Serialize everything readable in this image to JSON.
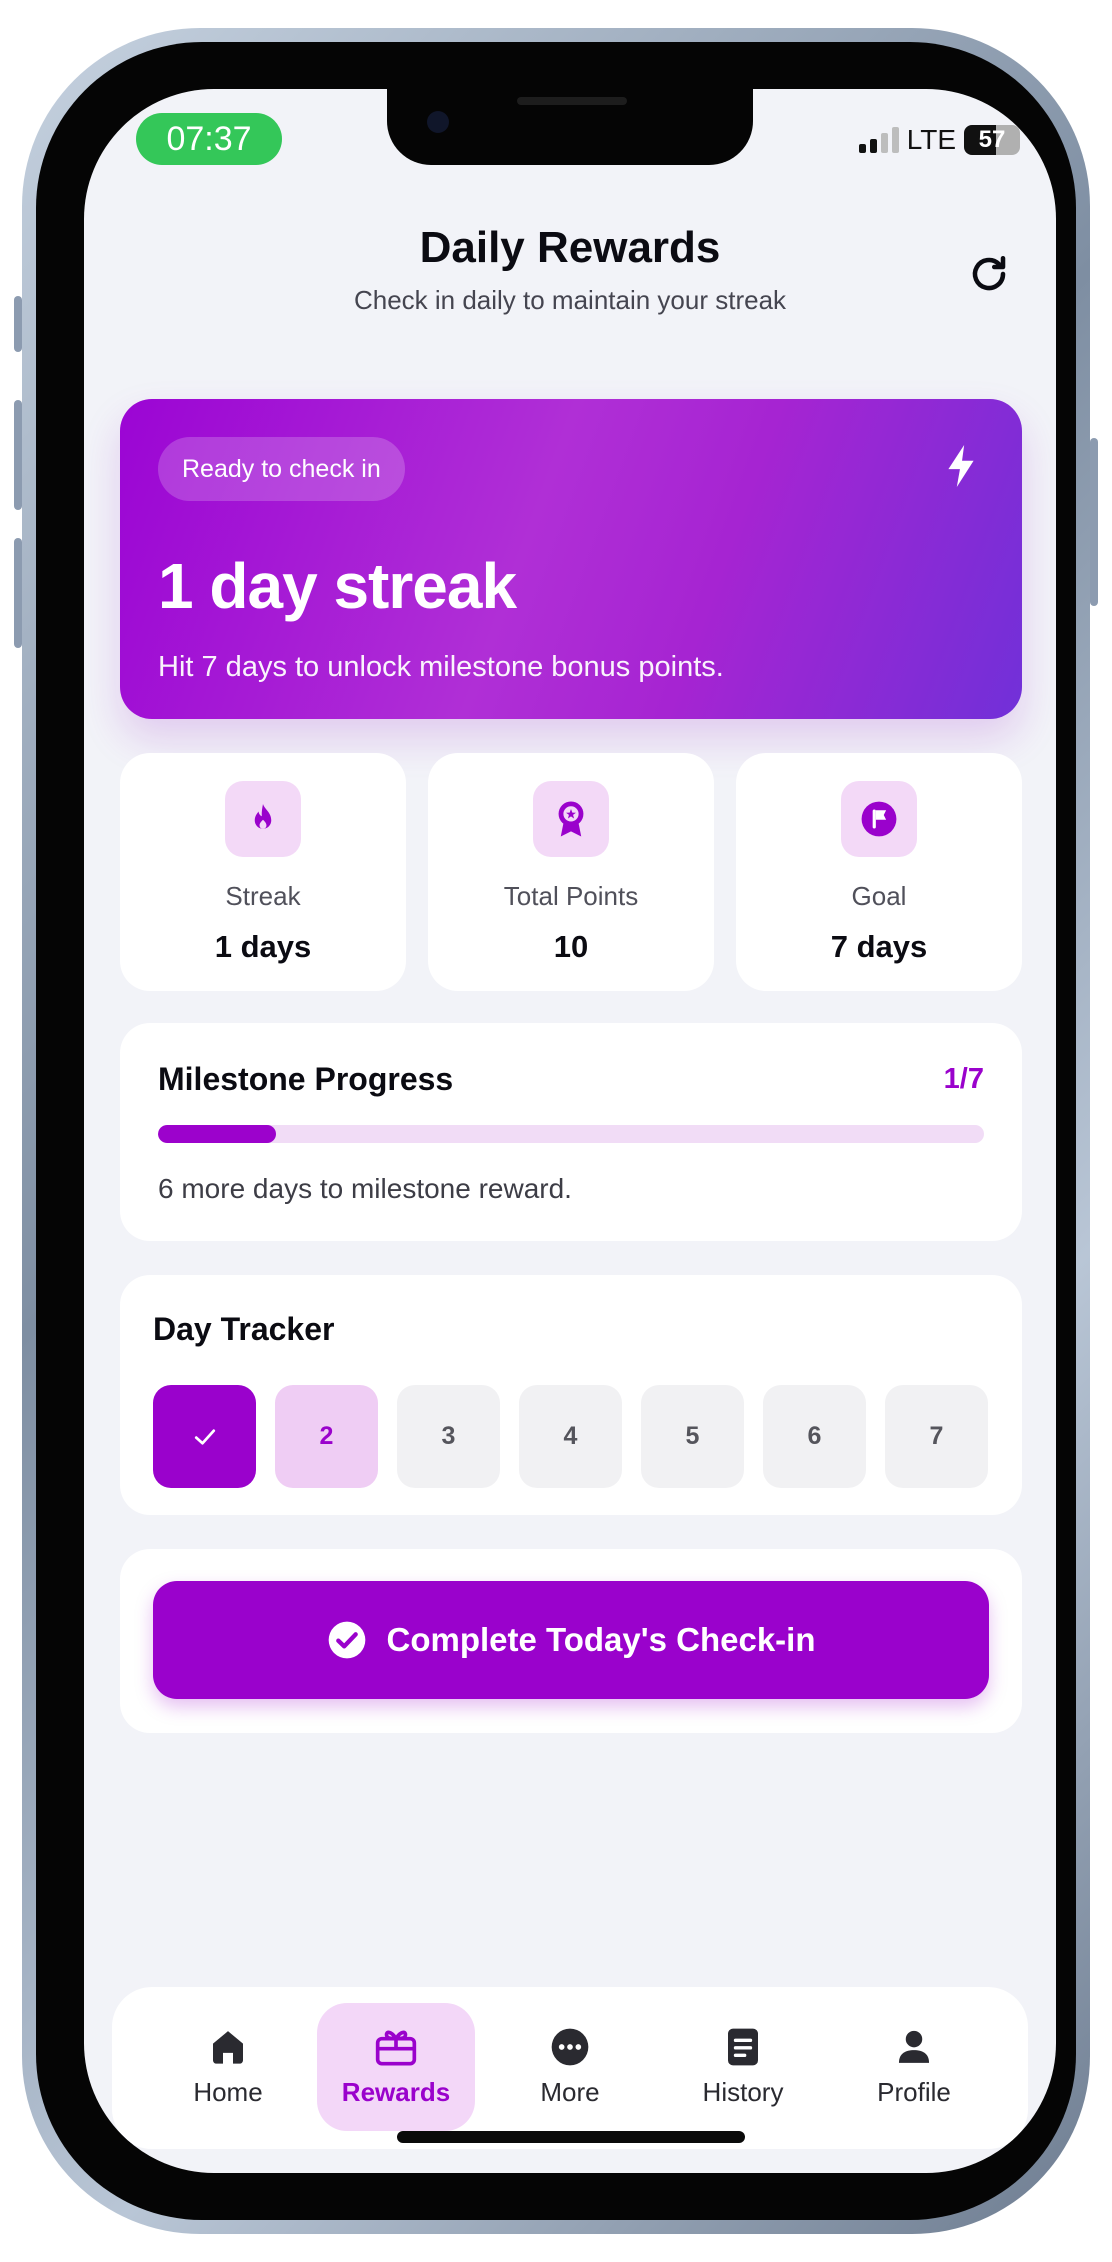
{
  "status_bar": {
    "time": "07:37",
    "network": "LTE",
    "battery": "57"
  },
  "header": {
    "title": "Daily Rewards",
    "subtitle": "Check in daily to maintain your streak"
  },
  "hero": {
    "badge": "Ready to check in",
    "title": "1 day streak",
    "subtitle": "Hit 7 days to unlock milestone bonus points."
  },
  "stats": [
    {
      "label": "Streak",
      "value": "1 days",
      "icon": "flame-icon"
    },
    {
      "label": "Total Points",
      "value": "10",
      "icon": "award-ribbon-icon"
    },
    {
      "label": "Goal",
      "value": "7 days",
      "icon": "flag-icon"
    }
  ],
  "milestone": {
    "title": "Milestone Progress",
    "count": "1/7",
    "progress": 0.143,
    "note": "6 more days to milestone reward."
  },
  "tracker": {
    "title": "Day Tracker",
    "days": [
      {
        "label": "✓",
        "state": "done"
      },
      {
        "label": "2",
        "state": "today"
      },
      {
        "label": "3",
        "state": "upcoming"
      },
      {
        "label": "4",
        "state": "upcoming"
      },
      {
        "label": "5",
        "state": "upcoming"
      },
      {
        "label": "6",
        "state": "upcoming"
      },
      {
        "label": "7",
        "state": "upcoming"
      }
    ]
  },
  "cta": {
    "label": "Complete Today's Check-in"
  },
  "nav": {
    "items": [
      {
        "label": "Home",
        "icon": "home-icon"
      },
      {
        "label": "Rewards",
        "icon": "gift-icon",
        "active": true
      },
      {
        "label": "More",
        "icon": "more-icon"
      },
      {
        "label": "History",
        "icon": "history-icon"
      },
      {
        "label": "Profile",
        "icon": "profile-icon"
      }
    ]
  },
  "colors": {
    "accent": "#9a02cc",
    "accent_light": "#f3d9f7",
    "background": "#f2f3f8",
    "status_green": "#34c759"
  }
}
